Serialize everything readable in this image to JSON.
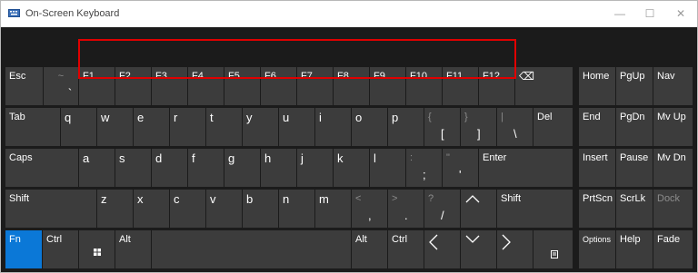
{
  "window": {
    "title": "On-Screen Keyboard",
    "icon": "keyboard-app-icon",
    "controls": {
      "minimize": "—",
      "maximize": "☐",
      "close": "✕"
    }
  },
  "colors": {
    "key": "#3c3c3c",
    "background": "#1b1b1b",
    "fn_active": "#0b78d7",
    "highlight": "#e00000"
  },
  "keys": {
    "esc": "Esc",
    "tilde_top": "~",
    "tilde_bottom": "`",
    "f1": "F1",
    "f2": "F2",
    "f3": "F3",
    "f4": "F4",
    "f5": "F5",
    "f6": "F6",
    "f7": "F7",
    "f8": "F8",
    "f9": "F9",
    "f10": "F10",
    "f11": "F11",
    "f12": "F12",
    "backspace": "⌫",
    "home": "Home",
    "pgup": "PgUp",
    "nav": "Nav",
    "tab": "Tab",
    "q": "q",
    "w": "w",
    "e": "e",
    "r": "r",
    "t": "t",
    "y": "y",
    "u": "u",
    "i": "i",
    "o": "o",
    "p": "p",
    "lbrace_top": "{",
    "lbrace_bottom": "[",
    "rbrace_top": "}",
    "rbrace_bottom": "]",
    "pipe_top": "|",
    "pipe_bottom": "\\",
    "del": "Del",
    "end": "End",
    "pgdn": "PgDn",
    "mvup": "Mv Up",
    "caps": "Caps",
    "a": "a",
    "s": "s",
    "d": "d",
    "f": "f",
    "g": "g",
    "h": "h",
    "j": "j",
    "k": "k",
    "l": "l",
    "colon_top": ":",
    "colon_bottom": ";",
    "quote_top": "\"",
    "quote_bottom": "'",
    "enter": "Enter",
    "insert": "Insert",
    "pause": "Pause",
    "mvdn": "Mv Dn",
    "shift": "Shift",
    "z": "z",
    "x": "x",
    "c": "c",
    "v": "v",
    "b": "b",
    "n": "n",
    "m": "m",
    "lt_top": "<",
    "lt_bottom": ",",
    "gt_top": ">",
    "gt_bottom": ".",
    "q_top": "?",
    "q_bottom": "/",
    "up": "^",
    "shift_r": "Shift",
    "prtscn": "PrtScn",
    "scrlk": "ScrLk",
    "dock": "Dock",
    "fn": "Fn",
    "ctrl": "Ctrl",
    "win": "⊞",
    "alt": "Alt",
    "alt_r": "Alt",
    "ctrl_r": "Ctrl",
    "left": "<",
    "down": "∨",
    "right": ">",
    "menu": "≣",
    "options": "Options",
    "help": "Help",
    "fade": "Fade"
  }
}
